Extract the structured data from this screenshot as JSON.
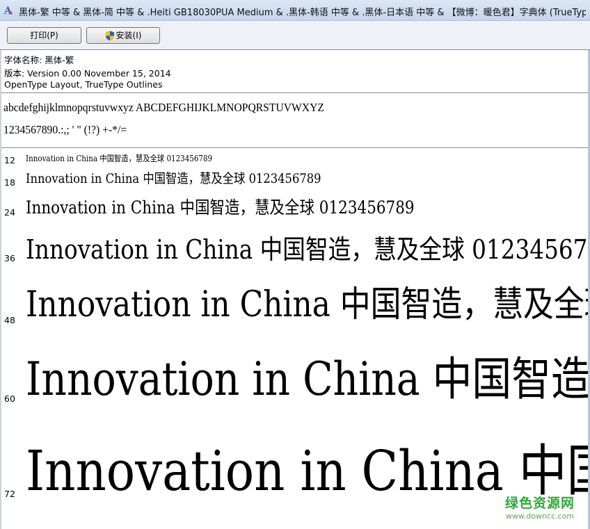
{
  "window": {
    "title": "黑体-繁 中等 & 黑体-简 中等  & .Heiti GB18030PUA Medium  & .黑体-韩语 中等  & .黑体-日本语 中等  & 【微博：暖色君】字典体 (TrueType)"
  },
  "toolbar": {
    "print_label": "打印(P)",
    "install_label": "安装(I)"
  },
  "font_info": {
    "name_line": "字体名称: 黑体-繁",
    "version_line": "版本: Version 0.00 November 15, 2014",
    "outline_line": "OpenType Layout, TrueType Outlines"
  },
  "charset": {
    "letters": "abcdefghijklmnopqrstuvwxyz ABCDEFGHIJKLMNOPQRSTUVWXYZ",
    "digits": "1234567890.:,; ' \" (!?) +-*/="
  },
  "samples": {
    "text": "Innovation in China 中国智造，慧及全球 0123456789",
    "rows": [
      {
        "size": "12"
      },
      {
        "size": "18"
      },
      {
        "size": "24"
      },
      {
        "size": "36"
      },
      {
        "size": "48"
      },
      {
        "size": "60"
      },
      {
        "size": "72"
      }
    ]
  },
  "watermark": {
    "main": "绿色资源网",
    "url": "www.downcc.com"
  },
  "icons": {
    "title": "font-viewer-icon",
    "install": "uac-shield-icon"
  }
}
